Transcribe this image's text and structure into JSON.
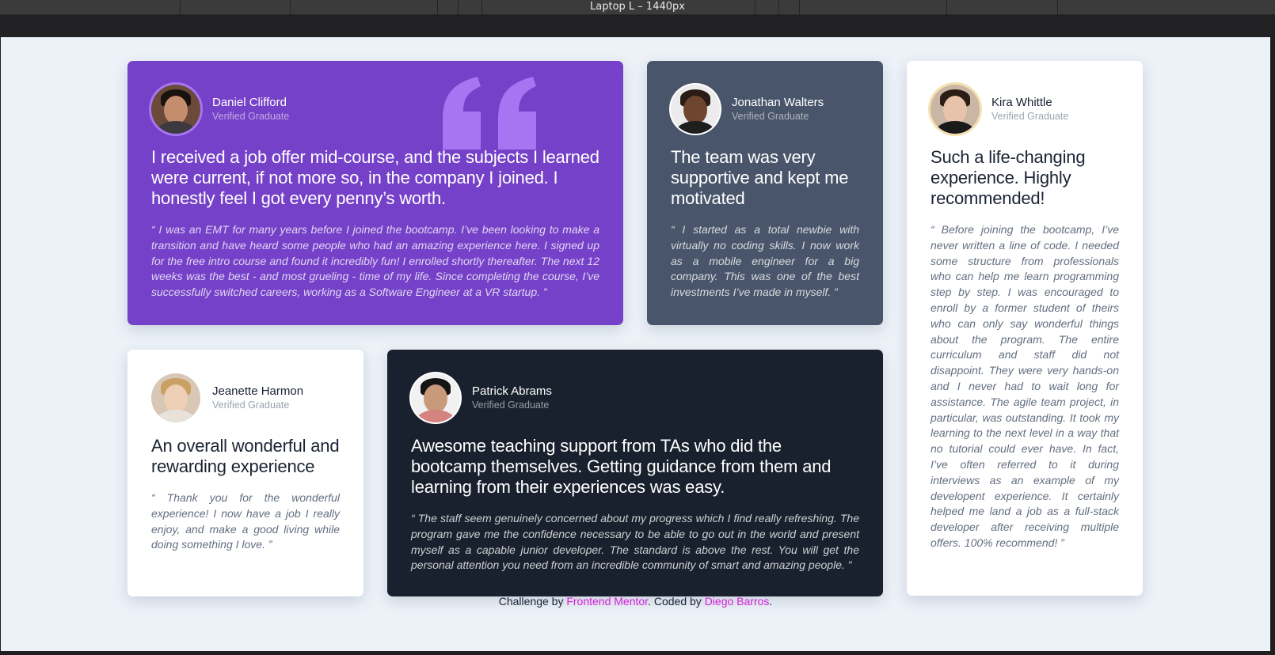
{
  "devtools": {
    "title": "Laptop L – 1440px"
  },
  "testimonials": [
    {
      "id": "daniel",
      "name": "Daniel Clifford",
      "role": "Verified Graduate",
      "headline": "I received a job offer mid-course, and the subjects I learned were current, if not more so, in the company I joined. I honestly feel I got every penny’s worth.",
      "body": "“ I was an EMT for many years before I joined the bootcamp. I’ve been looking to make a transition and have heard some people who had an amazing experience here. I signed up for the free intro course and found it incredibly fun! I enrolled shortly thereafter. The next 12 weeks was the best - and most grueling - time of my life. Since completing the course, I’ve successfully switched careers, working as a Software Engineer at a VR startup. ”"
    },
    {
      "id": "jonathan",
      "name": "Jonathan Walters",
      "role": "Verified Graduate",
      "headline": "The team was very supportive and kept me motivated",
      "body": "“ I started as a total newbie with virtually no coding skills. I now work as a mobile engineer for a big company. This was one of the best investments I’ve made in myself. ”"
    },
    {
      "id": "kira",
      "name": "Kira Whittle",
      "role": "Verified Graduate",
      "headline": "Such a life-changing experience. Highly recommended!",
      "body": "“ Before joining the bootcamp, I’ve never written a line of code. I needed some structure from professionals who can help me learn programming step by step. I was encouraged to enroll by a former student of theirs who can only say wonderful things about the program. The entire curriculum and staff did not disappoint. They were very hands-on and I never had to wait long for assistance. The agile team project, in particular, was outstanding. It took my learning to the next level in a way that no tutorial could ever have. In fact, I’ve often referred to it during interviews as an example of my developent experience. It certainly helped me land a job as a full-stack developer after receiving multiple offers. 100% recommend! ”"
    },
    {
      "id": "jeanette",
      "name": "Jeanette Harmon",
      "role": "Verified Graduate",
      "headline": "An overall wonderful and rewarding experience",
      "body": "“ Thank you for the wonderful experience! I now have a job I really enjoy, and make a good living while doing something I love. ”"
    },
    {
      "id": "patrick",
      "name": "Patrick Abrams",
      "role": "Verified Graduate",
      "headline": "Awesome teaching support from TAs who did the bootcamp themselves. Getting guidance from them and learning from their experiences was easy.",
      "body": "“ The staff seem genuinely concerned about my progress which I find really refreshing. The program gave me the confidence necessary to be able to go out in the world and present myself as a capable junior developer. The standard is above the rest. You will get the personal attention you need from an incredible community of smart and amazing people. ”"
    }
  ],
  "footer": {
    "prefix": "Challenge by ",
    "link1": "Frontend Mentor",
    "middle": ". Coded by ",
    "link2": "Diego Barros",
    "suffix": "."
  },
  "colors": {
    "purple": "#7541c8",
    "grey_blue": "#48556a",
    "dark": "#19212e",
    "background": "#edf2f8",
    "link": "#d61fd8"
  }
}
